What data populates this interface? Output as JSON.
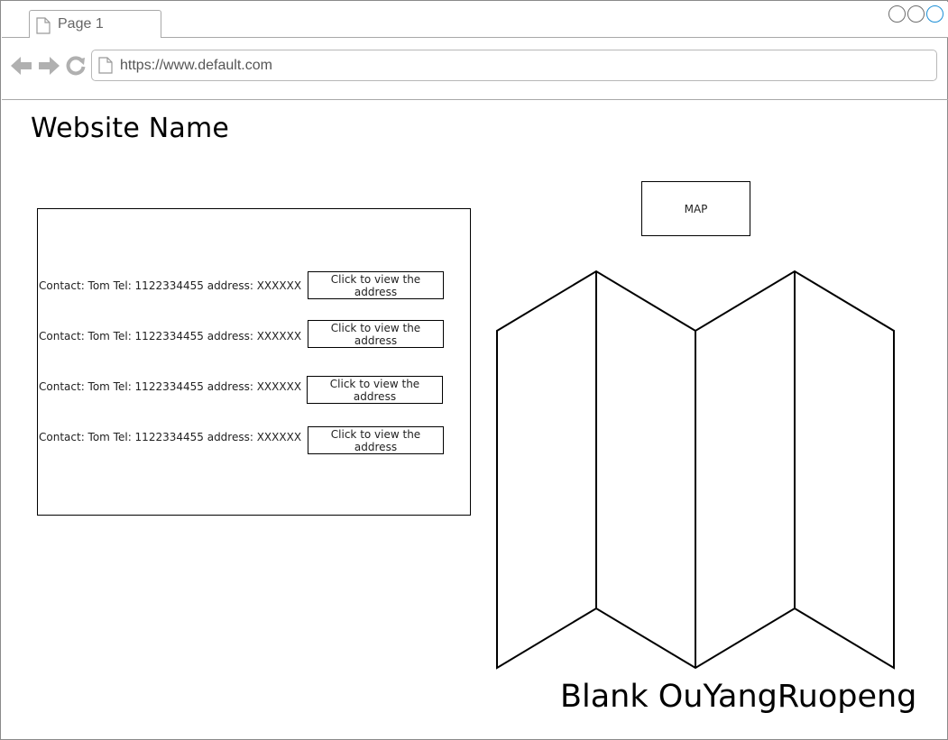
{
  "browser": {
    "tab_label": "Page 1",
    "url": "https://www.default.com",
    "icons": {
      "back": "back-arrow-icon",
      "forward": "forward-arrow-icon",
      "reload": "reload-icon",
      "page": "page-icon"
    },
    "accent_color": "#1c8fd6"
  },
  "page": {
    "title": "Website Name",
    "contacts": [
      {
        "text": "Contact: Tom Tel: 1122334455 address: XXXXXX",
        "button": "Click to view the address"
      },
      {
        "text": "Contact: Tom Tel: 1122334455 address: XXXXXX",
        "button": "Click to view the address"
      },
      {
        "text": "Contact: Tom Tel: 1122334455 address: XXXXXX",
        "button": "Click to view the address"
      },
      {
        "text": "Contact: Tom Tel: 1122334455 address: XXXXXX",
        "button": "Click to view the address"
      }
    ],
    "map_button": "MAP",
    "map_icon": "folded-map-icon",
    "signature": "Blank OuYangRuopeng"
  }
}
